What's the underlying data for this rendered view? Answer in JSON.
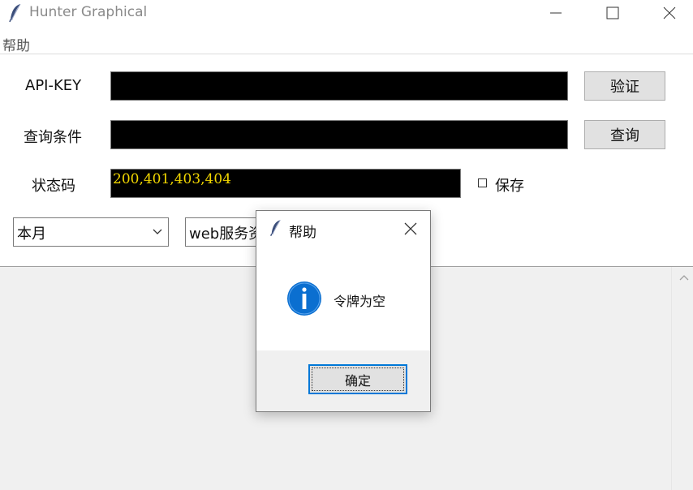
{
  "window": {
    "title": "Hunter Graphical"
  },
  "menu": {
    "help": "帮助"
  },
  "form": {
    "api_key_label": "API-KEY",
    "api_key_value": "",
    "verify_button": "验证",
    "query_label": "查询条件",
    "query_value": "",
    "query_button": "查询",
    "status_label": "状态码",
    "status_value": "200,401,403,404",
    "save_label": "保存",
    "save_checked": false,
    "date_range": "本月",
    "asset_type": "web服务资产"
  },
  "dialog": {
    "title": "帮助",
    "message": "令牌为空",
    "ok_button": "确定"
  },
  "colors": {
    "field_bg": "#000000",
    "field_text": "#f1d600",
    "accent": "#0078d7"
  }
}
